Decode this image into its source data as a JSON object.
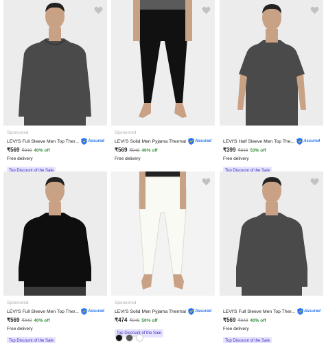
{
  "products": [
    {
      "sponsored": "Sponsored",
      "title": "LEVI'S Full Sleeve Men Top Ther...",
      "assured": "Assured",
      "price": "₹569",
      "mrp": "₹949",
      "discount": "40% off",
      "delivery": "Free delivery",
      "badge": "Top Discount of the Sale",
      "image": "man-grey-full-sleeve-thermal-top"
    },
    {
      "sponsored": "Sponsored",
      "title": "LEVI'S Solid Men Pyjama Thermal",
      "assured": "Assured",
      "price": "₹569",
      "mrp": "₹949",
      "discount": "40% off",
      "delivery": "Free delivery",
      "badge": "",
      "image": "black-thermal-pyjama"
    },
    {
      "sponsored": "",
      "title": "LEVI'S Half Sleeve Men Top The...",
      "assured": "Assured",
      "price": "₹399",
      "mrp": "₹849",
      "discount": "53% off",
      "delivery": "Free delivery",
      "badge": "Top Discount of the Sale",
      "image": "man-grey-half-sleeve-thermal-top"
    },
    {
      "sponsored": "Sponsored",
      "title": "LEVI'S Full Sleeve Men Top Ther...",
      "assured": "Assured",
      "price": "₹569",
      "mrp": "₹949",
      "discount": "40% off",
      "delivery": "Free delivery",
      "badge": "Top Discount of the Sale",
      "image": "man-black-full-sleeve-thermal-top"
    },
    {
      "sponsored": "Sponsored",
      "title": "LEVI'S Solid Men Pyjama Thermal",
      "assured": "Assured",
      "price": "₹474",
      "mrp": "₹949",
      "discount": "50% off",
      "delivery": "",
      "badge": "Top Discount of the Sale",
      "image": "white-thermal-pyjama"
    },
    {
      "sponsored": "",
      "title": "LEVI'S Full Sleeve Men Top Ther...",
      "assured": "Assured",
      "price": "₹569",
      "mrp": "₹949",
      "discount": "40% off",
      "delivery": "Free delivery",
      "badge": "Top Discount of the Sale",
      "image": "man-grey-full-sleeve-thermal-top"
    }
  ],
  "colors": {
    "assured": "#2874f0",
    "discount": "#388e3c",
    "badge_bg": "#e6e3ff",
    "badge_text": "#3a2ab8"
  },
  "swatch_colors": [
    "#111111",
    "#555555",
    "#ffffff"
  ]
}
